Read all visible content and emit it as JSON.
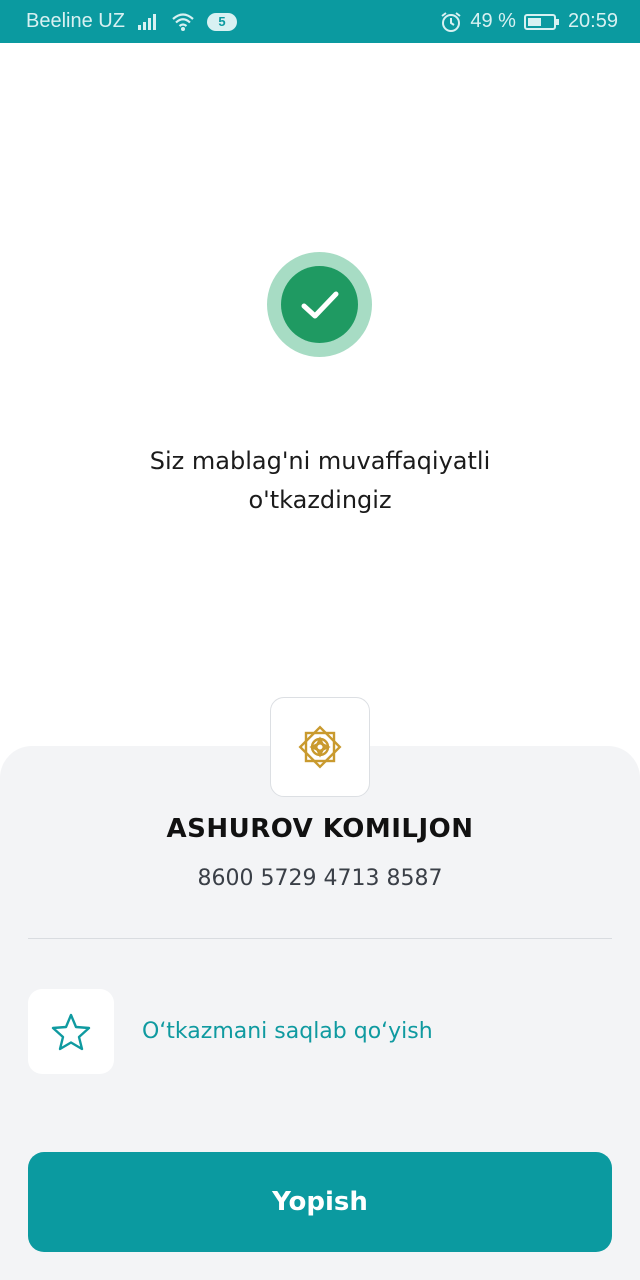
{
  "status_bar": {
    "carrier": "Beeline UZ",
    "sim_badge": "5",
    "battery": "49 %",
    "time": "20:59",
    "icons": [
      "signal-icon",
      "wifi-icon",
      "alarm-icon",
      "battery-icon"
    ]
  },
  "success": {
    "icon": "checkmark-icon",
    "message_line1": "Siz mablag'ni muvaffaqiyatli",
    "message_line2": "o'tkazdingiz"
  },
  "recipient": {
    "logo": "bank-logo-icon",
    "name": "ASHUROV KOMILJON",
    "card_number": "8600 5729 4713 8587"
  },
  "actions": {
    "save_label": "O‘tkazmani saqlab qo‘yish",
    "save_icon": "star-icon",
    "close_label": "Yopish"
  },
  "colors": {
    "accent": "#0b9aa0",
    "success": "#1f9a62",
    "success_ring": "#a7dcc4",
    "logo_gold": "#c99a2e"
  }
}
